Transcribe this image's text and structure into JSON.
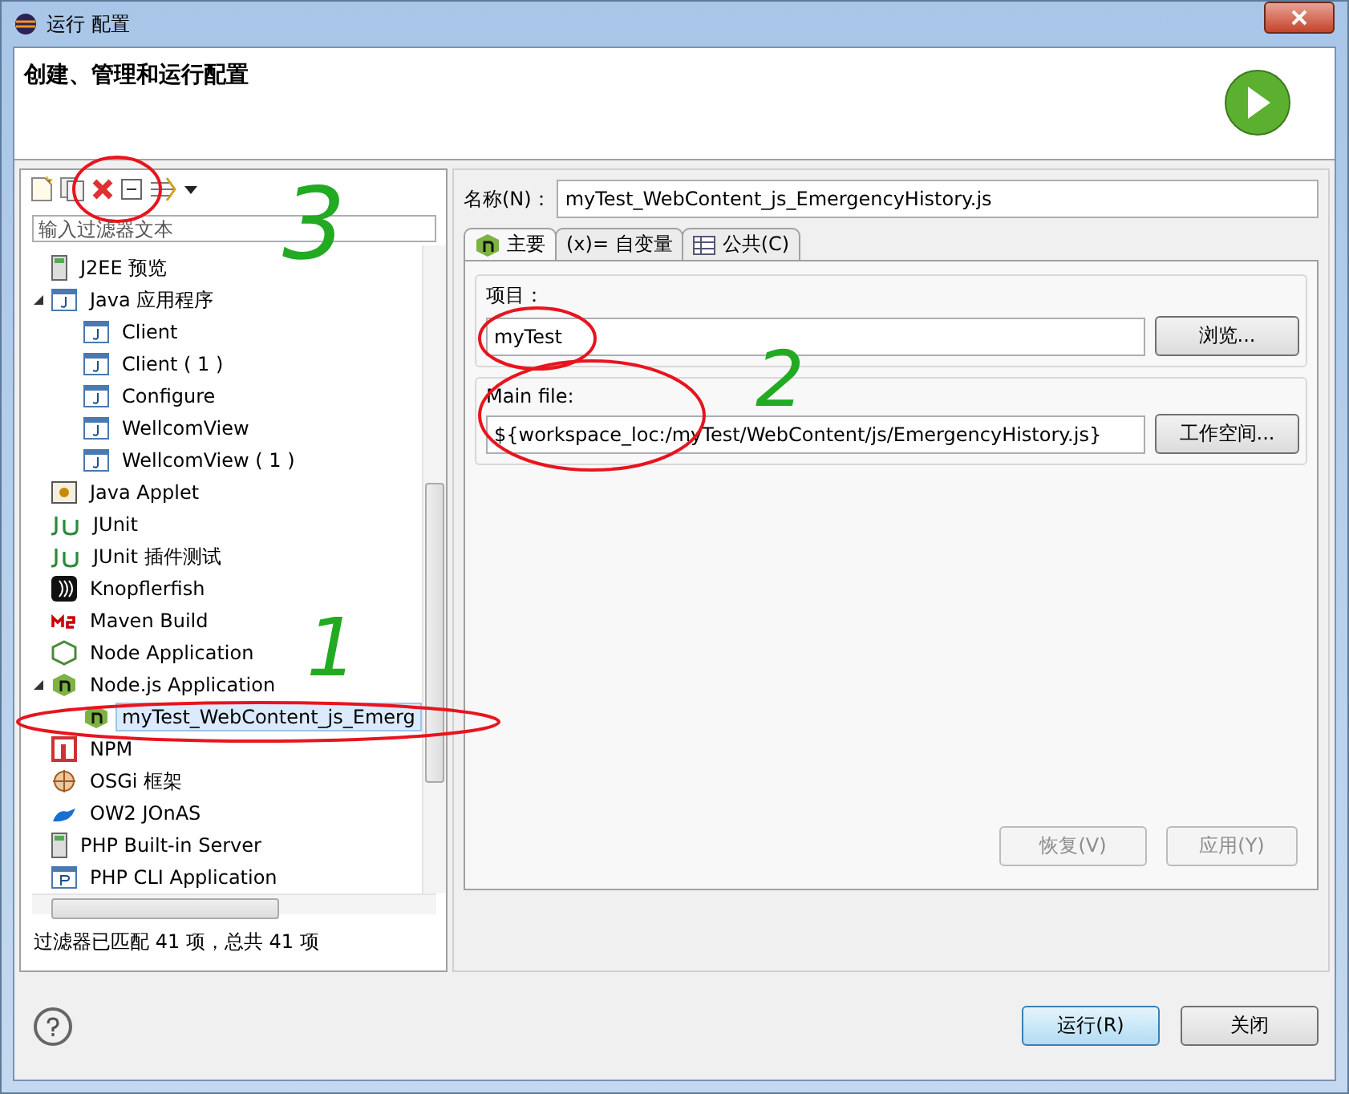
{
  "window": {
    "title": "运行 配置"
  },
  "header": {
    "title": "创建、管理和运行配置"
  },
  "toolbar": {
    "items": [
      {
        "kind": "new"
      },
      {
        "kind": "duplicate"
      },
      {
        "kind": "delete"
      },
      {
        "kind": "collapse"
      },
      {
        "kind": "filter"
      },
      {
        "kind": "dropdown"
      }
    ]
  },
  "filter": {
    "placeholder": "输入过滤器文本"
  },
  "tree": [
    {
      "label": "J2EE 预览",
      "kind": "server",
      "selected": false
    },
    {
      "label": "Java 应用程序",
      "kind": "java",
      "selected": false,
      "expanded": true,
      "children": [
        {
          "label": "Client",
          "kind": "java",
          "selected": false
        },
        {
          "label": "Client ( 1 )",
          "kind": "java",
          "selected": false
        },
        {
          "label": "Configure",
          "kind": "java",
          "selected": false
        },
        {
          "label": "WellcomView",
          "kind": "java",
          "selected": false
        },
        {
          "label": "WellcomView ( 1 )",
          "kind": "java",
          "selected": false
        }
      ]
    },
    {
      "label": "Java Applet",
      "kind": "applet",
      "selected": false
    },
    {
      "label": "JUnit",
      "kind": "junit",
      "selected": false
    },
    {
      "label": "JUnit 插件测试",
      "kind": "junit",
      "selected": false
    },
    {
      "label": "Knopflerfish",
      "kind": "knopflerfish",
      "selected": false
    },
    {
      "label": "Maven Build",
      "kind": "maven",
      "selected": false
    },
    {
      "label": "Node Application",
      "kind": "node",
      "selected": false
    },
    {
      "label": "Node.js Application",
      "kind": "nodejs",
      "selected": false,
      "expanded": true,
      "children": [
        {
          "label": "myTest_WebContent_js_Emerg",
          "kind": "nodejs",
          "selected": true
        }
      ]
    },
    {
      "label": "NPM",
      "kind": "npm",
      "selected": false
    },
    {
      "label": "OSGi 框架",
      "kind": "osgi",
      "selected": false
    },
    {
      "label": "OW2 JOnAS",
      "kind": "jonas",
      "selected": false
    },
    {
      "label": "PHP Built-in Server",
      "kind": "server",
      "selected": false
    },
    {
      "label": "PHP CLI Application",
      "kind": "php",
      "selected": false
    }
  ],
  "status": "过滤器已匹配 41 项，总共 41 项",
  "name_label": "名称(N)：",
  "name_value": "myTest_WebContent_js_EmergencyHistory.js",
  "tabs": [
    {
      "label": "主要",
      "kind": "nodejs",
      "selected": true
    },
    {
      "label": "(x)= 自变量",
      "kind": "plain",
      "selected": false
    },
    {
      "label": "公共(C)",
      "kind": "table",
      "selected": false
    }
  ],
  "groups": [
    {
      "label": "项目：",
      "value": "myTest",
      "button": "浏览..."
    },
    {
      "label": "Main file:",
      "value": "${workspace_loc:/myTest/WebContent/js/EmergencyHistory.js}",
      "button": "工作空间..."
    }
  ],
  "panel_buttons": [
    {
      "label": "恢复(V)",
      "disabled": true
    },
    {
      "label": "应用(Y)",
      "disabled": true
    }
  ],
  "dialog_buttons": [
    {
      "label": "运行(R)",
      "default": true
    },
    {
      "label": "关闭",
      "default": false
    }
  ],
  "annotations": [
    {
      "kind": "circle"
    },
    {
      "kind": "number",
      "text": "3"
    },
    {
      "kind": "circle"
    },
    {
      "kind": "number",
      "text": "1"
    },
    {
      "kind": "circle"
    },
    {
      "kind": "circle"
    },
    {
      "kind": "number",
      "text": "2"
    }
  ]
}
